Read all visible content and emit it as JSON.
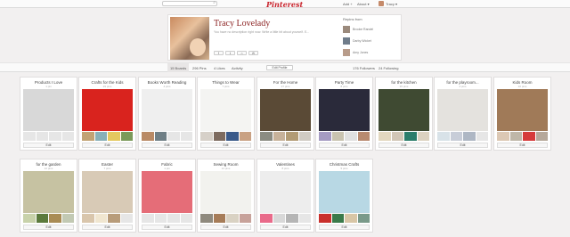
{
  "topbar": {
    "logo": "Pinterest",
    "nav": [
      "Add +",
      "About ▾",
      "Tracy ▾"
    ]
  },
  "profile": {
    "name": "Tracy Lovelady",
    "description": "You have no description right now. Write a little bit about yourself. E...",
    "social": [
      "f",
      "t",
      "⌂",
      "✉"
    ],
    "repins_heading": "Repins from",
    "repins_from": [
      "Brooke Randel",
      "Darby Wicket",
      "Amy Jones"
    ]
  },
  "stats": {
    "boards": "15 Boards",
    "pins": "296 Pins",
    "likes": "4 Likes",
    "activity": "Activity",
    "edit_profile": "Edit Profile",
    "followers": "176 Followers",
    "following": "24 Following"
  },
  "boards": [
    {
      "title": "Products I Love",
      "count": "1 pin",
      "edit": "Edit",
      "cover": "#d8d8d8",
      "thumbs": [
        "#e6e6e6",
        "#e6e6e6",
        "#e6e6e6",
        "#e6e6e6"
      ]
    },
    {
      "title": "Crafts for the Kids",
      "count": "29 pins",
      "edit": "Edit",
      "cover": "#d9231e",
      "thumbs": [
        "#c2a374",
        "#88b0b8",
        "#e4c85f",
        "#7b9a5a"
      ]
    },
    {
      "title": "Books Worth Reading",
      "count": "4 pins",
      "edit": "Edit",
      "cover": "#efefef",
      "thumbs": [
        "#b98a65",
        "#6f7f86",
        "#e6e6e6",
        "#e6e6e6"
      ]
    },
    {
      "title": "Things to Wear",
      "count": "7 pins",
      "edit": "Edit",
      "cover": "#f4f4f2",
      "thumbs": [
        "#d6d0c8",
        "#7d6b5f",
        "#3a5a8a",
        "#c9a183"
      ]
    },
    {
      "title": "For the Home",
      "count": "27 pins",
      "edit": "Edit",
      "cover": "#5a4a36",
      "thumbs": [
        "#8b8c82",
        "#c7b29a",
        "#b29b74",
        "#d0cbc3"
      ]
    },
    {
      "title": "Party Time",
      "count": "8 pins",
      "edit": "Edit",
      "cover": "#2a2a3a",
      "thumbs": [
        "#a59bc2",
        "#c9c3b0",
        "#e0e0e0",
        "#b88a6f"
      ]
    },
    {
      "title": "for the kitchen",
      "count": "35 pins",
      "edit": "Edit",
      "cover": "#3f4a32",
      "thumbs": [
        "#e2d7bf",
        "#d1c6b6",
        "#2b7d6b",
        "#dcd2c0"
      ]
    },
    {
      "title": "for the playroom...",
      "count": "4 pins",
      "edit": "Edit",
      "cover": "#e4e2de",
      "thumbs": [
        "#d8e2e8",
        "#c8cdd8",
        "#aeb7c4",
        "#e6e6e6"
      ]
    },
    {
      "title": "Kids Room",
      "count": "10 pins",
      "edit": "Edit",
      "cover": "#a07a58",
      "thumbs": [
        "#dcc8b4",
        "#bfb7a8",
        "#d63a3a",
        "#b6a89a"
      ]
    },
    {
      "title": "for the garden",
      "count": "12 pins",
      "edit": "Edit",
      "cover": "#c6c2a2",
      "thumbs": [
        "#c8d2aa",
        "#5b7a3c",
        "#a98c55",
        "#c2c9b3"
      ]
    },
    {
      "title": "Easter",
      "count": "7 pins",
      "edit": "Edit",
      "cover": "#d8cab6",
      "thumbs": [
        "#d9c6ac",
        "#f0e6d0",
        "#b89c7a",
        "#e6e6e6"
      ]
    },
    {
      "title": "Fabric",
      "count": "1 pin",
      "edit": "Edit",
      "cover": "#e56d78",
      "thumbs": [
        "#e6e6e6",
        "#e6e6e6",
        "#e6e6e6",
        "#e6e6e6"
      ]
    },
    {
      "title": "Sewing Room",
      "count": "12 pins",
      "edit": "Edit",
      "cover": "#f2f2ee",
      "thumbs": [
        "#8f8a7e",
        "#a67c58",
        "#d9d2c3",
        "#c7a29a"
      ]
    },
    {
      "title": "Valentines",
      "count": "8 pins",
      "edit": "Edit",
      "cover": "#ededed",
      "thumbs": [
        "#e96a8a",
        "#d8d8d8",
        "#b5b5b5",
        "#e6e6e6"
      ]
    },
    {
      "title": "Christmas Crafts",
      "count": "5 pins",
      "edit": "Edit",
      "cover": "#b8d8e4",
      "thumbs": [
        "#c9302c",
        "#3a7a4a",
        "#d8c6a6",
        "#7a9a8a"
      ]
    }
  ]
}
